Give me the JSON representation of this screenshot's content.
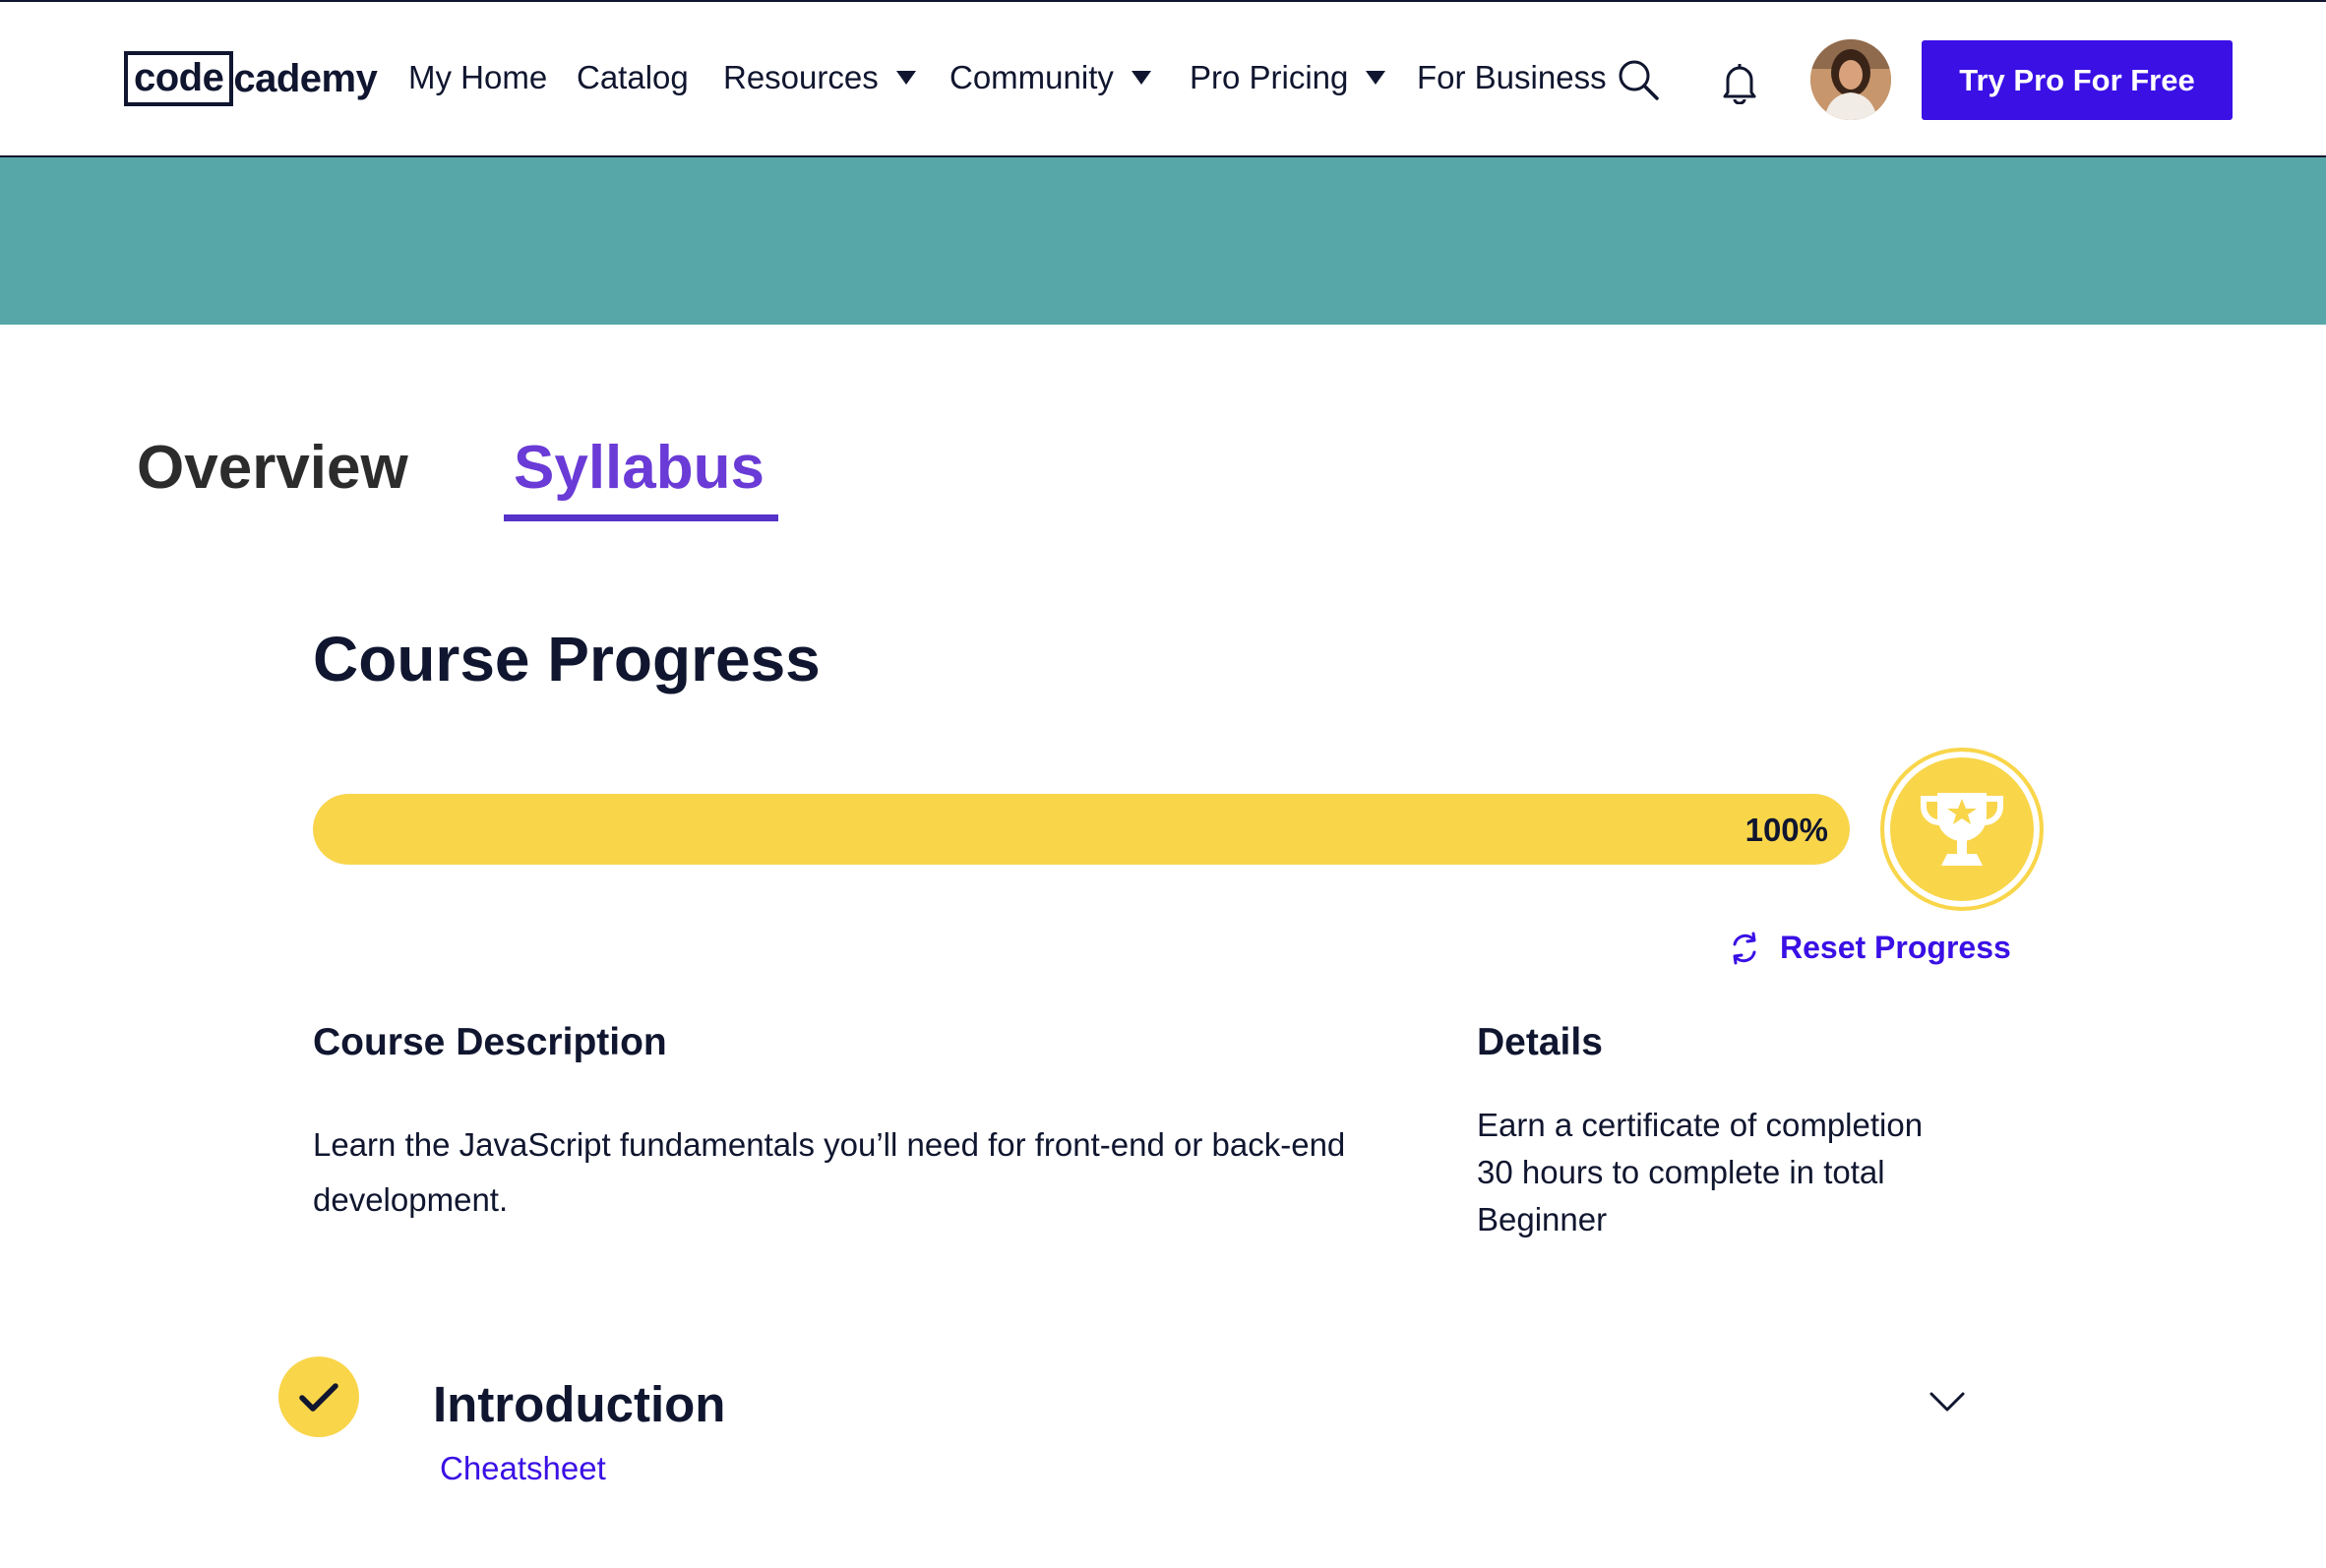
{
  "header": {
    "logo_code": "code",
    "logo_rest": "cademy",
    "nav": {
      "my_home": "My Home",
      "catalog": "Catalog",
      "resources": "Resources",
      "community": "Community",
      "pro_pricing": "Pro Pricing",
      "for_business": "For Business"
    },
    "icons": {
      "search": "search-icon",
      "notifications": "bell-icon",
      "avatar": "user-avatar",
      "dropdown": "caret-down-icon"
    },
    "cta": "Try Pro For Free"
  },
  "banner": {
    "color": "#58a7a8"
  },
  "tabs": {
    "overview": "Overview",
    "syllabus": "Syllabus",
    "active": "syllabus"
  },
  "progress": {
    "title": "Course Progress",
    "percent": 100,
    "label": "100%",
    "reset": "Reset Progress",
    "trophy_icon": "trophy-icon",
    "reset_icon": "refresh-icon"
  },
  "course": {
    "description_heading": "Course Description",
    "description": "Learn the JavaScript fundamentals you’ll need for front-end or back-end development.",
    "details_heading": "Details",
    "details": [
      "Earn a certificate of completion",
      "30 hours to complete in total",
      "Beginner"
    ]
  },
  "modules": [
    {
      "title": "Introduction",
      "link": "Cheatsheet",
      "completed": true,
      "status_icon": "checkmark-icon",
      "expand_icon": "chevron-down-icon"
    }
  ],
  "colors": {
    "brand_blue": "#3a10e5",
    "tab_purple": "#6a3bd6",
    "progress_yellow": "#f9d54a",
    "navy_text": "#10162f"
  }
}
